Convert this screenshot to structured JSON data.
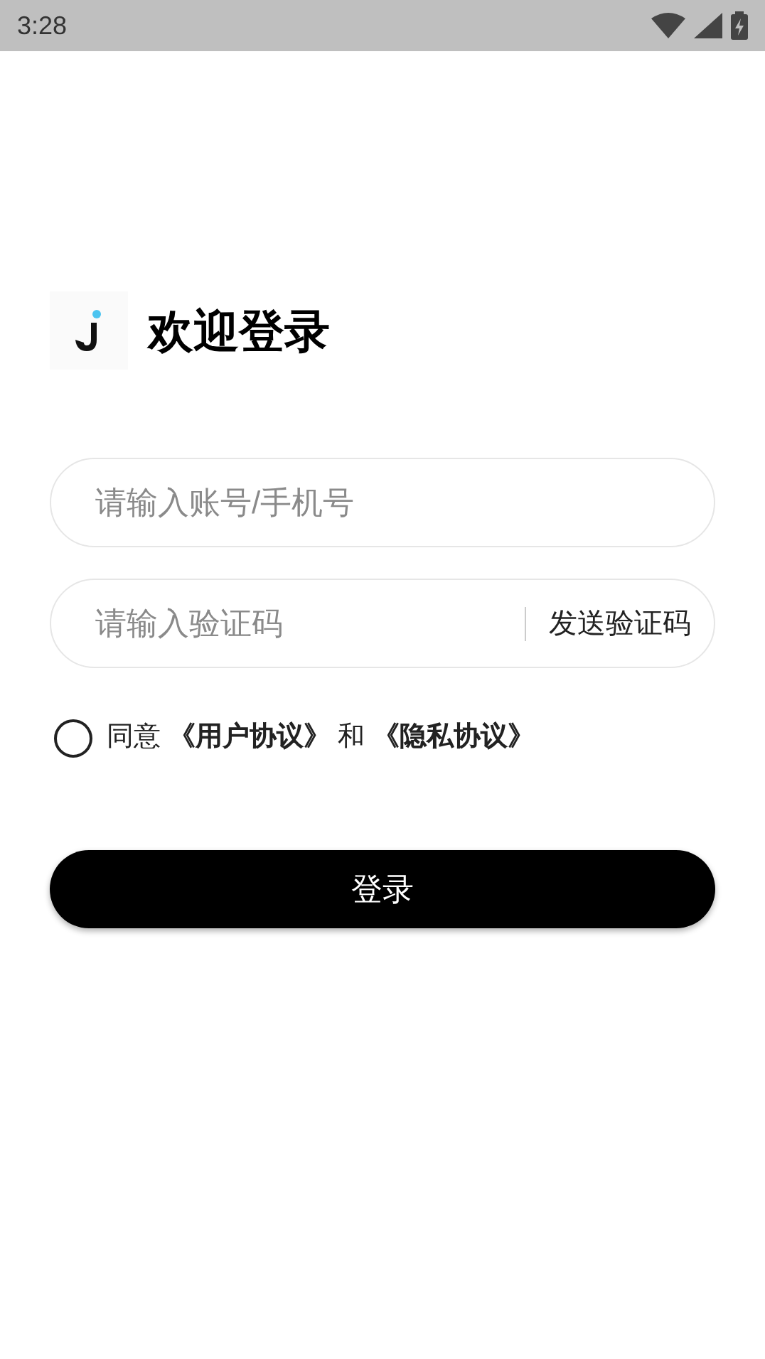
{
  "status_bar": {
    "time": "3:28"
  },
  "title": "欢迎登录",
  "account_field": {
    "placeholder": "请输入账号/手机号"
  },
  "code_field": {
    "placeholder": "请输入验证码",
    "send_button": "发送验证码"
  },
  "agreement": {
    "checked": false,
    "prefix": "同意",
    "links": [
      "《用户协议》",
      "《隐私协议》"
    ],
    "joiner": "和"
  },
  "login_button": "登录"
}
